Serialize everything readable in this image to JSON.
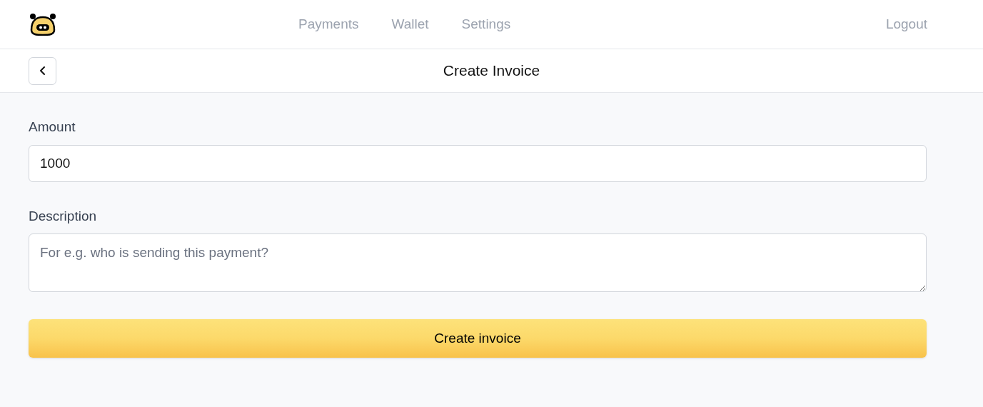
{
  "nav": {
    "items": [
      {
        "label": "Payments"
      },
      {
        "label": "Wallet"
      },
      {
        "label": "Settings"
      }
    ],
    "logout": "Logout"
  },
  "page": {
    "title": "Create Invoice"
  },
  "form": {
    "fields": [
      {
        "kind": "input",
        "label": "Amount",
        "value": "1000"
      },
      {
        "kind": "textarea",
        "label": "Description",
        "placeholder": "For e.g. who is sending this payment?"
      }
    ],
    "submit": "Create invoice"
  }
}
